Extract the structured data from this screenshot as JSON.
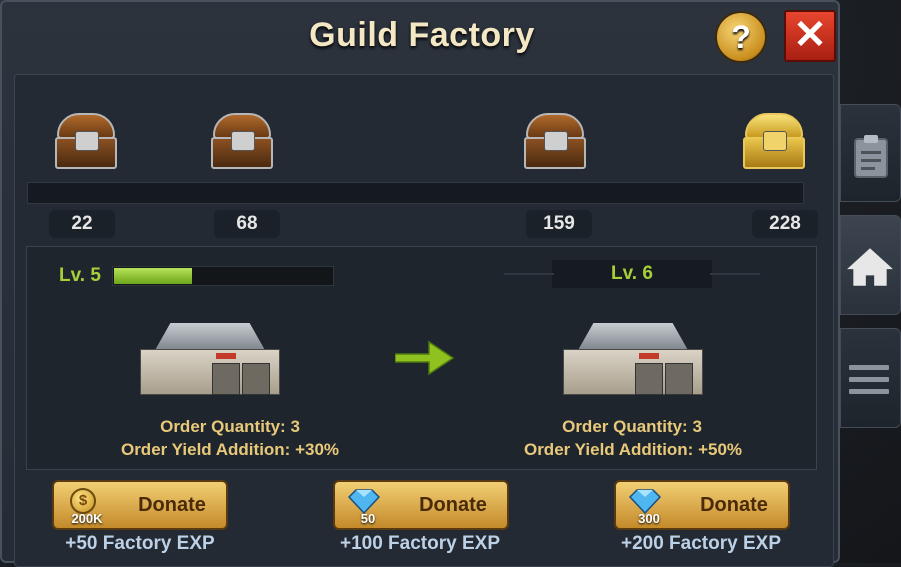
{
  "title": "Guild Factory",
  "buttons": {
    "help": "?",
    "close": "✕"
  },
  "milestones": [
    {
      "value": "22",
      "chest": "bronze-chest"
    },
    {
      "value": "68",
      "chest": "bronze-chest"
    },
    {
      "value": "159",
      "chest": "bronze-chest"
    },
    {
      "value": "228",
      "chest": "gold-chest"
    }
  ],
  "milestone_progress": 0,
  "current": {
    "level": "Lv. 5",
    "exp_progress": 0.36,
    "order_quantity": "Order Quantity: 3",
    "yield_addition": "Order Yield Addition:  +30%"
  },
  "next": {
    "level": "Lv. 6",
    "order_quantity": "Order Quantity: 3",
    "yield_addition": "Order Yield Addition:  +50%"
  },
  "donations": [
    {
      "label": "Donate",
      "cost": "200K",
      "currency": "gold-coin",
      "exp": "+50 Factory EXP"
    },
    {
      "label": "Donate",
      "cost": "50",
      "currency": "diamond",
      "exp": "+100 Factory EXP"
    },
    {
      "label": "Donate",
      "cost": "300",
      "currency": "diamond",
      "exp": "+200 Factory EXP"
    }
  ],
  "sidebar": [
    "clipboard-icon",
    "home-icon",
    "menu-icon"
  ],
  "colors": {
    "accent_green": "#a6cf3a",
    "gold_text": "#e8c97a",
    "button_gold": "#f2cf74",
    "close_red": "#d63a24"
  }
}
